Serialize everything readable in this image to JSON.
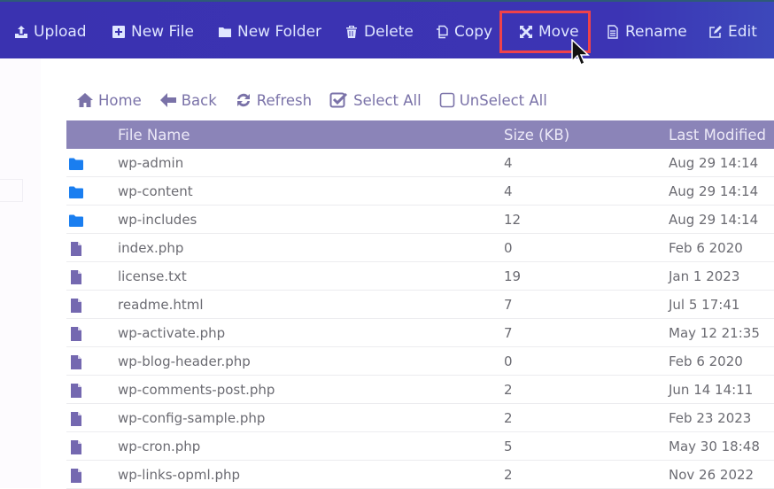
{
  "toolbar": {
    "buttons": [
      {
        "label": "Upload",
        "icon": "upload-icon"
      },
      {
        "label": "New File",
        "icon": "plus-square-icon"
      },
      {
        "label": "New Folder",
        "icon": "folder-icon"
      },
      {
        "label": "Delete",
        "icon": "trash-icon"
      },
      {
        "label": "Copy",
        "icon": "copy-icon"
      },
      {
        "label": "Move",
        "icon": "move-arrows-icon",
        "highlighted": true
      },
      {
        "label": "Rename",
        "icon": "file-text-icon"
      },
      {
        "label": "Edit",
        "icon": "edit-icon"
      }
    ],
    "highlight_color": "#f0424a",
    "background": "#3a32b0"
  },
  "nav": {
    "home": "Home",
    "back": "Back",
    "refresh": "Refresh",
    "select_all": "Select All",
    "unselect_all": "UnSelect All"
  },
  "table": {
    "headers": {
      "name": "File Name",
      "size": "Size (KB)",
      "modified": "Last Modified"
    },
    "rows": [
      {
        "type": "folder",
        "name": "wp-admin",
        "size": "4",
        "modified": "Aug 29 14:14"
      },
      {
        "type": "folder",
        "name": "wp-content",
        "size": "4",
        "modified": "Aug 29 14:14"
      },
      {
        "type": "folder",
        "name": "wp-includes",
        "size": "12",
        "modified": "Aug 29 14:14"
      },
      {
        "type": "file",
        "name": "index.php",
        "size": "0",
        "modified": "Feb 6 2020"
      },
      {
        "type": "file",
        "name": "license.txt",
        "size": "19",
        "modified": "Jan 1 2023"
      },
      {
        "type": "file",
        "name": "readme.html",
        "size": "7",
        "modified": "Jul 5 17:41"
      },
      {
        "type": "file",
        "name": "wp-activate.php",
        "size": "7",
        "modified": "May 12 21:35"
      },
      {
        "type": "file",
        "name": "wp-blog-header.php",
        "size": "0",
        "modified": "Feb 6 2020"
      },
      {
        "type": "file",
        "name": "wp-comments-post.php",
        "size": "2",
        "modified": "Jun 14 14:11"
      },
      {
        "type": "file",
        "name": "wp-config-sample.php",
        "size": "2",
        "modified": "Feb 23 2023"
      },
      {
        "type": "file",
        "name": "wp-cron.php",
        "size": "5",
        "modified": "May 30 18:48"
      },
      {
        "type": "file",
        "name": "wp-links-opml.php",
        "size": "2",
        "modified": "Nov 26 2022"
      }
    ],
    "folder_color": "#1a7ef0",
    "file_color": "#7468b0",
    "header_bg": "#8b84b8"
  }
}
